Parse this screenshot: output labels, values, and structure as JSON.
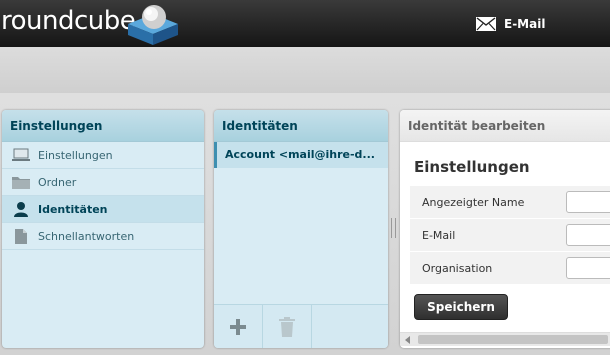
{
  "header": {
    "logo_text": "roundcube",
    "nav": {
      "mail_label": "E-Mail",
      "icon": "envelope-icon"
    }
  },
  "settings_panel": {
    "title": "Einstellungen",
    "items": [
      {
        "label": "Einstellungen",
        "icon": "laptop-icon",
        "selected": false
      },
      {
        "label": "Ordner",
        "icon": "folder-icon",
        "selected": false
      },
      {
        "label": "Identitäten",
        "icon": "user-icon",
        "selected": true
      },
      {
        "label": "Schnellantworten",
        "icon": "document-icon",
        "selected": false
      }
    ]
  },
  "identities_panel": {
    "title": "Identitäten",
    "rows": [
      {
        "label": "Account <mail@ihre-d..."
      }
    ],
    "footer": {
      "add_icon": "plus-icon",
      "delete_icon": "trash-icon"
    }
  },
  "edit_panel": {
    "title": "Identität bearbeiten",
    "section_title": "Einstellungen",
    "fields": [
      {
        "label": "Angezeigter Name",
        "value": ""
      },
      {
        "label": "E-Mail",
        "value": ""
      },
      {
        "label": "Organisation",
        "value": ""
      }
    ],
    "save_label": "Speichern"
  },
  "colors": {
    "header_bg": "#1c1c1c",
    "panel_header_bg": "#b2d7e3",
    "panel_header_text": "#004458",
    "list_bg": "#d9ecf4",
    "selected_bg": "#c5e1ec",
    "save_button_bg": "#3a3a3a"
  }
}
